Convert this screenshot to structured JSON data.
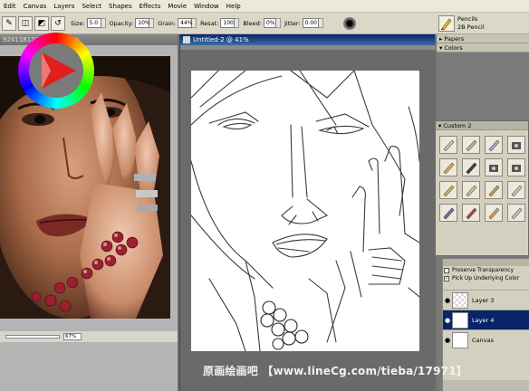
{
  "menu": [
    "Edit",
    "Canvas",
    "Layers",
    "Select",
    "Shapes",
    "Effects",
    "Movie",
    "Window",
    "Help"
  ],
  "property_bar": {
    "size_label": "Size:",
    "size_value": "5.0",
    "opacity_label": "Opacity:",
    "opacity_value": "10%",
    "grain_label": "Grain:",
    "grain_value": "44%",
    "resat_label": "Resat:",
    "resat_value": "100",
    "bleed_label": "Bleed:",
    "bleed_value": "0%",
    "jitter_label": "Jitter:",
    "jitter_value": "0.00"
  },
  "brush": {
    "category": "Pencils",
    "variant": "2B Pencil"
  },
  "reference_window": {
    "title": "9241181272.jpg @ 67%",
    "zoom": "67%"
  },
  "canvas_window": {
    "title": "Untitled-2 @ 41%"
  },
  "palettes": {
    "papers": "Papers",
    "colors": "Colors",
    "custom": "Custom 2"
  },
  "custom_brushes": [
    "pencil-icon",
    "pencil-icon",
    "pen-icon",
    "camera-icon",
    "pencil-icon",
    "marker-icon",
    "camera-icon",
    "camera-icon",
    "pencil-icon",
    "pencil-icon",
    "pencil-icon",
    "pencil-icon",
    "brush-icon",
    "pencil-icon",
    "pencil-icon",
    "pencil-icon"
  ],
  "layers": {
    "preserve_transparency": "Preserve Transparency",
    "pick_up_color": "Pick Up Underlying Color",
    "items": [
      {
        "name": "Layer 3"
      },
      {
        "name": "Layer 4"
      },
      {
        "name": "Canvas"
      }
    ]
  },
  "watermark": "原画绘画吧 【www.lineCg.com/tieba/17971】",
  "colors": {
    "selected_layer": "#0a246a",
    "active_title": "#0a246a",
    "hue_indicator": "#e0201c"
  }
}
